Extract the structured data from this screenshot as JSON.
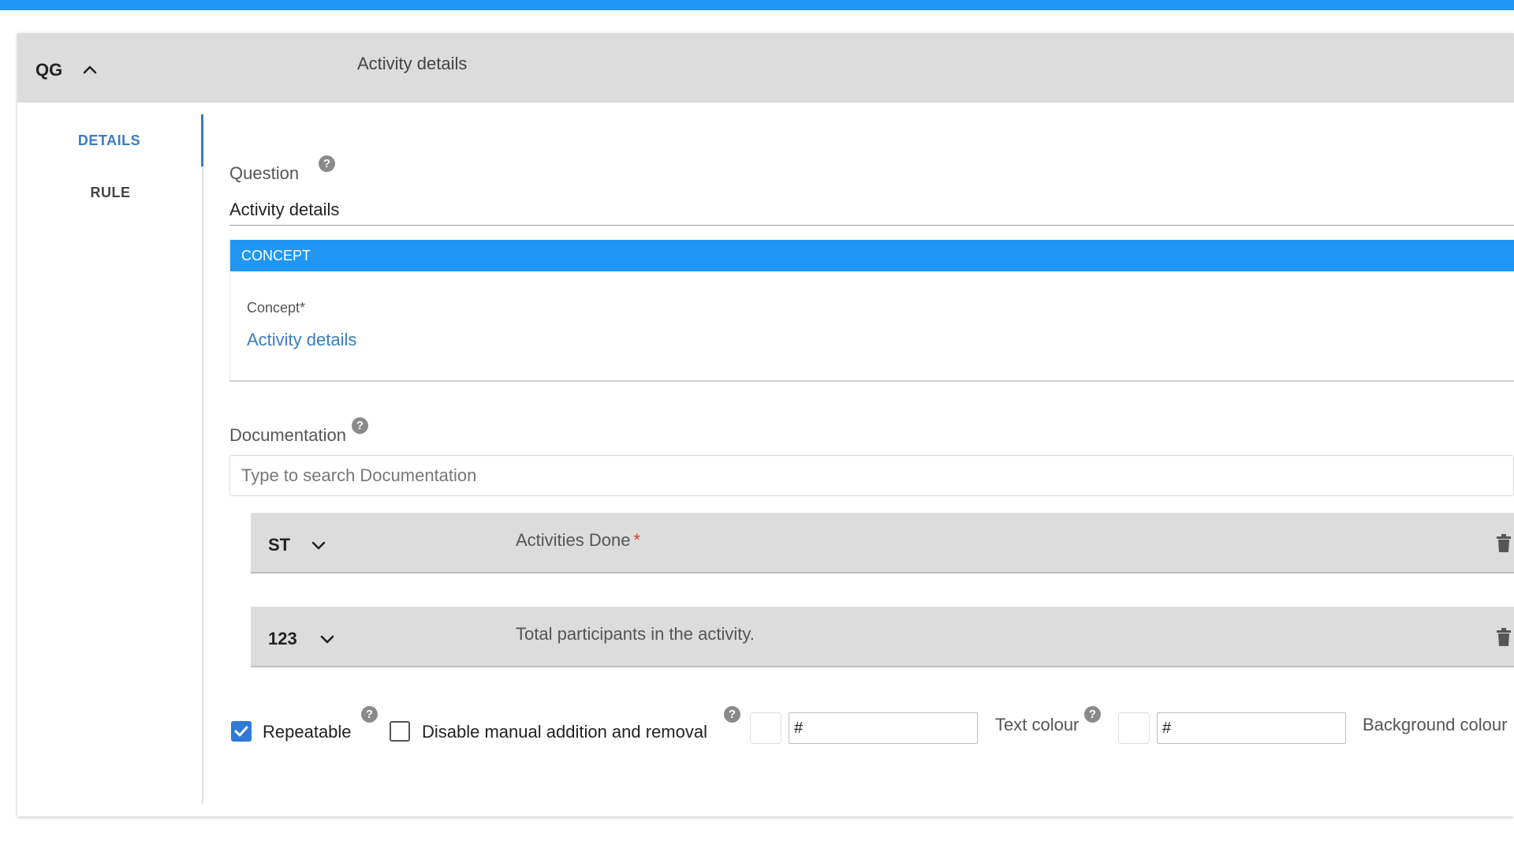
{
  "header": {
    "type_code": "QG",
    "title": "Activity details"
  },
  "tabs": [
    {
      "label": "DETAILS",
      "active": true
    },
    {
      "label": "RULE",
      "active": false
    }
  ],
  "question": {
    "label": "Question",
    "value": "Activity details",
    "help": "?"
  },
  "concept": {
    "section_label": "CONCEPT",
    "field_label": "Concept*",
    "value": "Activity details"
  },
  "documentation": {
    "label": "Documentation",
    "placeholder": "Type to search Documentation",
    "help": "?"
  },
  "children": [
    {
      "type_code": "ST",
      "title": "Activities Done",
      "required_mark": "*"
    },
    {
      "type_code": "123",
      "title": "Total participants in the activity."
    }
  ],
  "options": {
    "repeatable": {
      "label": "Repeatable",
      "checked": true,
      "help": "?"
    },
    "disable_manual": {
      "label": "Disable manual addition and removal",
      "checked": false,
      "help": "?"
    }
  },
  "colours": {
    "text": {
      "label": "Text colour",
      "value": "#",
      "help": "?"
    },
    "background": {
      "label": "Background colour",
      "value": "#"
    }
  },
  "theme": {
    "accent": "#2196f3",
    "link": "#3b7bc4",
    "header_bg": "#dcdcdc",
    "checkbox": "#2f7ad6",
    "required": "#e53935"
  }
}
